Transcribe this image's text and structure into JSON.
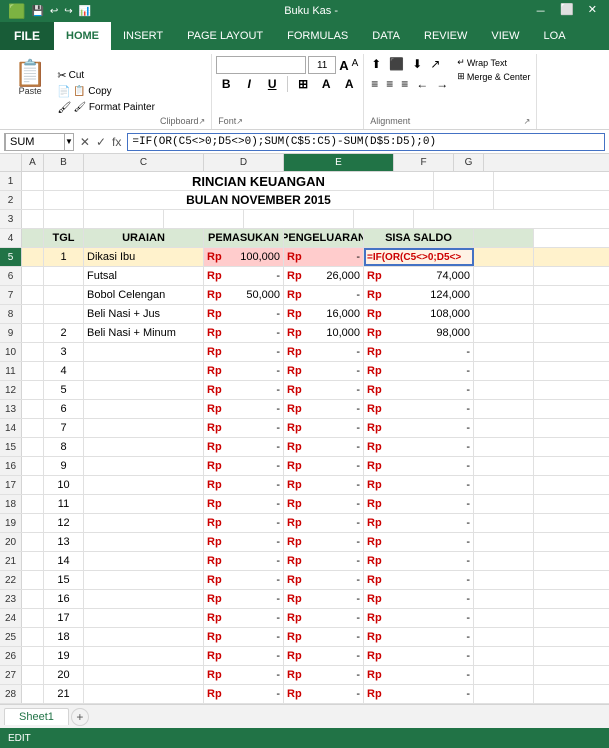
{
  "titleBar": {
    "filename": "Buku Kas -",
    "icons": [
      "minimize",
      "maximize",
      "close"
    ]
  },
  "ribbonTabs": [
    {
      "id": "file",
      "label": "FILE",
      "isFile": true
    },
    {
      "id": "home",
      "label": "HOME",
      "active": true
    },
    {
      "id": "insert",
      "label": "INSERT"
    },
    {
      "id": "pagelayout",
      "label": "PAGE LAYOUT"
    },
    {
      "id": "formulas",
      "label": "FORMULAS"
    },
    {
      "id": "data",
      "label": "DATA"
    },
    {
      "id": "review",
      "label": "REVIEW"
    },
    {
      "id": "view",
      "label": "VIEW"
    },
    {
      "id": "loa",
      "label": "LOA"
    }
  ],
  "clipboard": {
    "paste": "Paste",
    "cut": "✂ Cut",
    "copy": "📋 Copy",
    "formatPainter": "🖌 Format Painter",
    "label": "Clipboard"
  },
  "font": {
    "name": "",
    "size": "11",
    "bold": "B",
    "italic": "I",
    "underline": "U",
    "label": "Font",
    "sizeUp": "A",
    "sizeDown": "A"
  },
  "alignment": {
    "label": "Alignment",
    "wrapText": "Wrap Text",
    "mergeCenter": "Merge & Center"
  },
  "formulaBar": {
    "nameBox": "SUM",
    "formula": "=IF(OR(C5<>0;D5<>0);SUM(C$5:C5)-SUM(D$5:D5);0)"
  },
  "spreadsheet": {
    "title1": "RINCIAN KEUANGAN",
    "title2": "BULAN NOVEMBER 2015",
    "headers": [
      "TGL",
      "URAIAN",
      "PEMASUKAN",
      "PENGELUARAN",
      "SISA SALDO"
    ],
    "colHeaders": [
      "",
      "A",
      "B",
      "C",
      "D",
      "E",
      "F",
      "G"
    ],
    "rows": [
      {
        "rowNum": "1",
        "cells": [
          "",
          "",
          "",
          "",
          "",
          "",
          ""
        ]
      },
      {
        "rowNum": "2",
        "cells": [
          "",
          "",
          "",
          "",
          "",
          "",
          ""
        ]
      },
      {
        "rowNum": "3",
        "cells": [
          "",
          "",
          "",
          "",
          "",
          "",
          ""
        ]
      },
      {
        "rowNum": "4",
        "cells": [
          "",
          "TGL",
          "URAIAN",
          "PEMASUKAN",
          "PENGELUARAN",
          "SISA SALDO",
          ""
        ]
      },
      {
        "rowNum": "5",
        "tgl": "1",
        "uraian": "Dikasi Ibu",
        "pemasukanRp": "Rp",
        "pemasukanVal": "100,000",
        "pengeluaranRp": "Rp",
        "pengeluaranVal": "-",
        "sisaFormula": "=IF(OR(C5<>0;D5<>",
        "active": true
      },
      {
        "rowNum": "6",
        "tgl": "",
        "uraian": "Futsal",
        "pemasukanRp": "Rp",
        "pemasukanVal": "-",
        "pengeluaranRp": "Rp",
        "pengeluaranVal": "26,000",
        "sisaRp": "Rp",
        "sisaVal": "74,000"
      },
      {
        "rowNum": "7",
        "tgl": "",
        "uraian": "Bobol Celengan",
        "pemasukanRp": "Rp",
        "pemasukanVal": "50,000",
        "pengeluaranRp": "Rp",
        "pengeluaranVal": "-",
        "sisaRp": "Rp",
        "sisaVal": "124,000"
      },
      {
        "rowNum": "8",
        "tgl": "",
        "uraian": "Beli Nasi + Jus",
        "pemasukanRp": "Rp",
        "pemasukanVal": "-",
        "pengeluaranRp": "Rp",
        "pengeluaranVal": "16,000",
        "sisaRp": "Rp",
        "sisaVal": "108,000"
      },
      {
        "rowNum": "9",
        "tgl": "2",
        "uraian": "Beli Nasi + Minum",
        "pemasukanRp": "Rp",
        "pemasukanVal": "-",
        "pengeluaranRp": "Rp",
        "pengeluaranVal": "10,000",
        "sisaRp": "Rp",
        "sisaVal": "98,000"
      },
      {
        "rowNum": "10",
        "tgl": "3",
        "uraian": "",
        "pemasukanRp": "Rp",
        "pemasukanVal": "-",
        "pengeluaranRp": "Rp",
        "pengeluaranVal": "-",
        "sisaRp": "Rp",
        "sisaVal": "-"
      },
      {
        "rowNum": "11",
        "tgl": "4",
        "uraian": "",
        "pemasukanRp": "Rp",
        "pemasukanVal": "-",
        "pengeluaranRp": "Rp",
        "pengeluaranVal": "-",
        "sisaRp": "Rp",
        "sisaVal": "-"
      },
      {
        "rowNum": "12",
        "tgl": "5",
        "uraian": "",
        "pemasukanRp": "Rp",
        "pemasukanVal": "-",
        "pengeluaranRp": "Rp",
        "pengeluaranVal": "-",
        "sisaRp": "Rp",
        "sisaVal": "-"
      },
      {
        "rowNum": "13",
        "tgl": "6",
        "uraian": "",
        "pemasukanRp": "Rp",
        "pemasukanVal": "-",
        "pengeluaranRp": "Rp",
        "pengeluaranVal": "-",
        "sisaRp": "Rp",
        "sisaVal": "-"
      },
      {
        "rowNum": "14",
        "tgl": "7",
        "uraian": "",
        "pemasukanRp": "Rp",
        "pemasukanVal": "-",
        "pengeluaranRp": "Rp",
        "pengeluaranVal": "-",
        "sisaRp": "Rp",
        "sisaVal": "-"
      },
      {
        "rowNum": "15",
        "tgl": "8",
        "uraian": "",
        "pemasukanRp": "Rp",
        "pemasukanVal": "-",
        "pengeluaranRp": "Rp",
        "pengeluaranVal": "-",
        "sisaRp": "Rp",
        "sisaVal": "-"
      },
      {
        "rowNum": "16",
        "tgl": "9",
        "uraian": "",
        "pemasukanRp": "Rp",
        "pemasukanVal": "-",
        "pengeluaranRp": "Rp",
        "pengeluaranVal": "-",
        "sisaRp": "Rp",
        "sisaVal": "-"
      },
      {
        "rowNum": "17",
        "tgl": "10",
        "uraian": "",
        "pemasukanRp": "Rp",
        "pemasukanVal": "-",
        "pengeluaranRp": "Rp",
        "pengeluaranVal": "-",
        "sisaRp": "Rp",
        "sisaVal": "-"
      },
      {
        "rowNum": "18",
        "tgl": "11",
        "uraian": "",
        "pemasukanRp": "Rp",
        "pemasukanVal": "-",
        "pengeluaranRp": "Rp",
        "pengeluaranVal": "-",
        "sisaRp": "Rp",
        "sisaVal": "-"
      },
      {
        "rowNum": "19",
        "tgl": "12",
        "uraian": "",
        "pemasukanRp": "Rp",
        "pemasukanVal": "-",
        "pengeluaranRp": "Rp",
        "pengeluaranVal": "-",
        "sisaRp": "Rp",
        "sisaVal": "-"
      },
      {
        "rowNum": "20",
        "tgl": "13",
        "uraian": "",
        "pemasukanRp": "Rp",
        "pemasukanVal": "-",
        "pengeluaranRp": "Rp",
        "pengeluaranVal": "-",
        "sisaRp": "Rp",
        "sisaVal": "-"
      },
      {
        "rowNum": "21",
        "tgl": "14",
        "uraian": "",
        "pemasukanRp": "Rp",
        "pemasukanVal": "-",
        "pengeluaranRp": "Rp",
        "pengeluaranVal": "-",
        "sisaRp": "Rp",
        "sisaVal": "-"
      },
      {
        "rowNum": "22",
        "tgl": "15",
        "uraian": "",
        "pemasukanRp": "Rp",
        "pemasukanVal": "-",
        "pengeluaranRp": "Rp",
        "pengeluaranVal": "-",
        "sisaRp": "Rp",
        "sisaVal": "-"
      },
      {
        "rowNum": "23",
        "tgl": "16",
        "uraian": "",
        "pemasukanRp": "Rp",
        "pemasukanVal": "-",
        "pengeluaranRp": "Rp",
        "pengeluaranVal": "-",
        "sisaRp": "Rp",
        "sisaVal": "-"
      },
      {
        "rowNum": "24",
        "tgl": "17",
        "uraian": "",
        "pemasukanRp": "Rp",
        "pemasukanVal": "-",
        "pengeluaranRp": "Rp",
        "pengeluaranVal": "-",
        "sisaRp": "Rp",
        "sisaVal": "-"
      },
      {
        "rowNum": "25",
        "tgl": "18",
        "uraian": "",
        "pemasukanRp": "Rp",
        "pemasukanVal": "-",
        "pengeluaranRp": "Rp",
        "pengeluaranVal": "-",
        "sisaRp": "Rp",
        "sisaVal": "-"
      },
      {
        "rowNum": "26",
        "tgl": "19",
        "uraian": "",
        "pemasukanRp": "Rp",
        "pemasukanVal": "-",
        "pengeluaranRp": "Rp",
        "pengeluaranVal": "-",
        "sisaRp": "Rp",
        "sisaVal": "-"
      },
      {
        "rowNum": "27",
        "tgl": "20",
        "uraian": "",
        "pemasukanRp": "Rp",
        "pemasukanVal": "-",
        "pengeluaranRp": "Rp",
        "pengeluaranVal": "-",
        "sisaRp": "Rp",
        "sisaVal": "-"
      },
      {
        "rowNum": "28",
        "tgl": "21",
        "uraian": "",
        "pemasukanRp": "Rp",
        "pemasukanVal": "-",
        "pengeluaranRp": "Rp",
        "pengeluaranVal": "-",
        "sisaRp": "Rp",
        "sisaVal": "-"
      }
    ]
  },
  "sheetTabs": [
    {
      "label": "Sheet1",
      "active": true
    }
  ],
  "statusBar": {
    "mode": "EDIT"
  }
}
